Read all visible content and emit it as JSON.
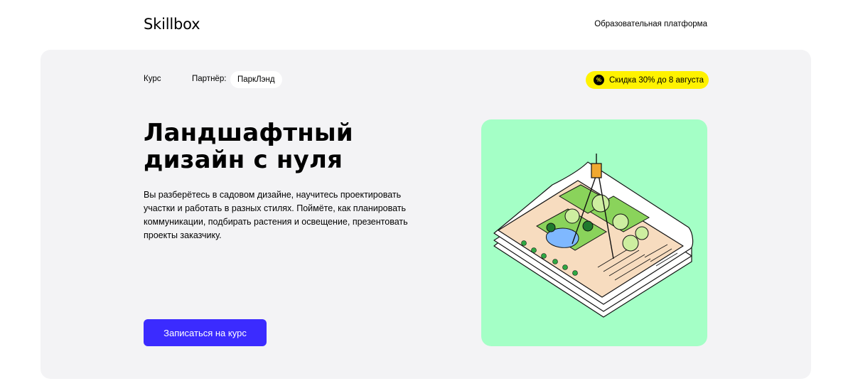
{
  "header": {
    "logo": "Skillbox",
    "tagline": "Образовательная платформа"
  },
  "hero": {
    "kind": "Курс",
    "partner_label": "Партнёр:",
    "partner_name": "ПаркЛэнд",
    "discount_icon": "%",
    "discount_text": "Скидка 30% до 8 августа",
    "title_line1": "Ландшафтный",
    "title_line2": "дизайн с нуля",
    "description": "Вы разберётесь в садовом дизайне, научитесь проектировать участки и работать в разных стилях. Поймёте, как планировать коммуникации, подбирать растения и освещение, презентовать проекты заказчику.",
    "cta_label": "Записаться на курс",
    "illustration": "isometric-garden-plan-with-compass"
  },
  "colors": {
    "accent": "#3b2bff",
    "discount": "#fff200",
    "panel": "#f3f3f5",
    "art_bg": "#a4ffc6"
  }
}
